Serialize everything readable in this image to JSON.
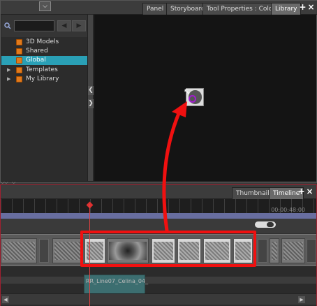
{
  "library_window": {
    "tabs": [
      "Panel",
      "Storyboard",
      "Tool Properties : Colour",
      "Library"
    ],
    "active_tab": "Library",
    "search": {
      "value": "",
      "placeholder": ""
    },
    "tree": [
      {
        "label": "3D Models",
        "expandable": false,
        "selected": false
      },
      {
        "label": "Shared",
        "expandable": false,
        "selected": false
      },
      {
        "label": "Global",
        "expandable": false,
        "selected": true
      },
      {
        "label": "Templates",
        "expandable": true,
        "selected": false
      },
      {
        "label": "My Library",
        "expandable": true,
        "selected": false
      }
    ],
    "window_controls": {
      "add": "+",
      "close": "×"
    }
  },
  "timeline_window": {
    "tabs": [
      "Thumbnails",
      "Timeline"
    ],
    "active_tab": "Timeline",
    "timecode": "00:00:48:00",
    "sound_clip_label": "RR_Line07_Celina_04_",
    "window_controls": {
      "add": "+",
      "close": "×"
    }
  },
  "icons": {
    "search": "search-icon",
    "folder": "folder-icon",
    "expand": "chevron-right-icon",
    "collapse_left": "chevron-left-icon",
    "collapse_right": "chevron-right-icon"
  },
  "colors": {
    "selected_item": "#2aa0b6",
    "folder": "#e17a1c",
    "annotation": "#f01010",
    "playhead": "#e04040"
  }
}
